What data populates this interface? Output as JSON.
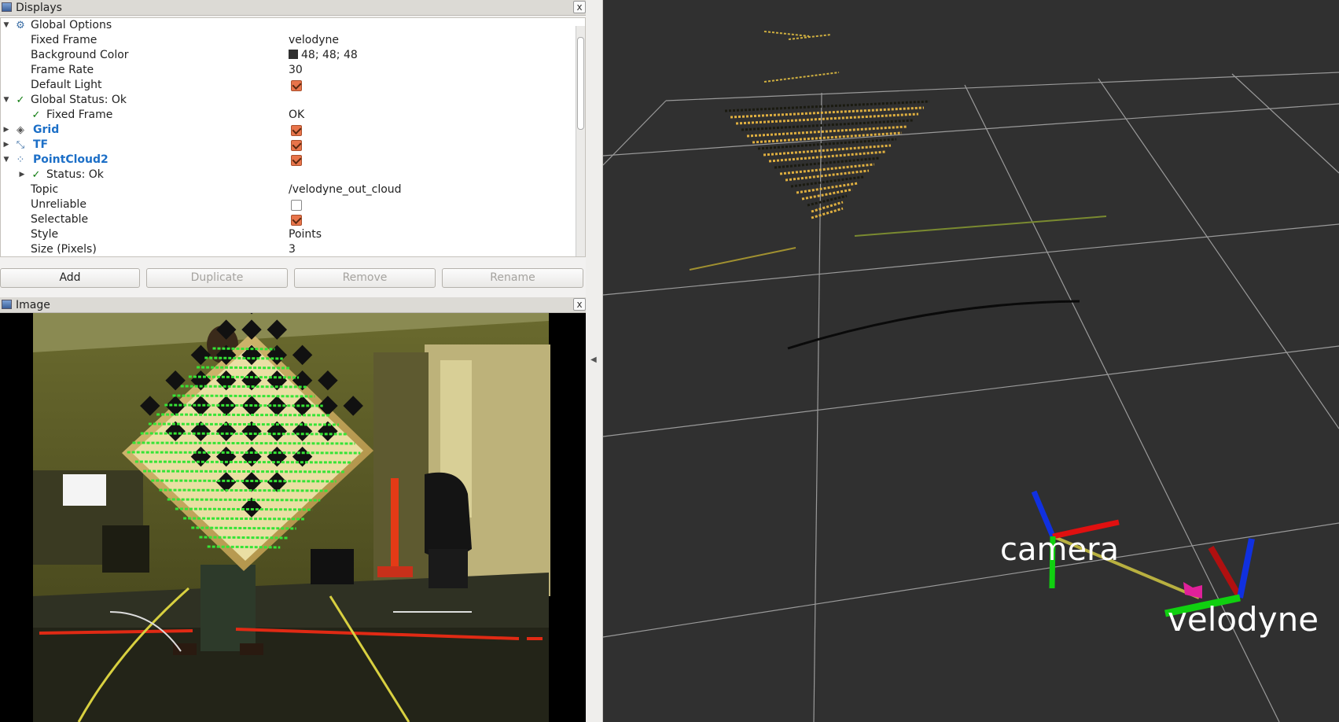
{
  "displays_panel": {
    "title": "Displays",
    "close": "x",
    "rows": [
      {
        "name": "Global Options",
        "value": ""
      },
      {
        "name": "Fixed Frame",
        "value": "velodyne"
      },
      {
        "name": "Background Color",
        "value": "48; 48; 48"
      },
      {
        "name": "Frame Rate",
        "value": "30"
      },
      {
        "name": "Default Light",
        "value": ""
      },
      {
        "name": "Global Status: Ok",
        "value": ""
      },
      {
        "name": "Fixed Frame",
        "value": "OK"
      },
      {
        "name": "Grid",
        "value": ""
      },
      {
        "name": "TF",
        "value": ""
      },
      {
        "name": "PointCloud2",
        "value": ""
      },
      {
        "name": "Status: Ok",
        "value": ""
      },
      {
        "name": "Topic",
        "value": "/velodyne_out_cloud"
      },
      {
        "name": "Unreliable",
        "value": ""
      },
      {
        "name": "Selectable",
        "value": ""
      },
      {
        "name": "Style",
        "value": "Points"
      },
      {
        "name": "Size (Pixels)",
        "value": "3"
      }
    ],
    "checkboxes": {
      "default_light": true,
      "grid": true,
      "tf": true,
      "pointcloud2": true,
      "unreliable": false,
      "selectable": true
    },
    "check_mark": "✓",
    "background_color_hex": "#303030"
  },
  "buttons": {
    "add": "Add",
    "duplicate": "Duplicate",
    "remove": "Remove",
    "rename": "Rename"
  },
  "image_panel": {
    "title": "Image",
    "close": "x"
  },
  "render_view": {
    "background": "#303030",
    "frames": {
      "camera": "camera",
      "velodyne": "velodyne"
    },
    "colors": {
      "axis_x": "#e01010",
      "axis_y": "#10d010",
      "axis_z": "#1030e0",
      "link": "#b8b040",
      "arrow": "#e0209a",
      "cloud": "#e0b040"
    }
  }
}
